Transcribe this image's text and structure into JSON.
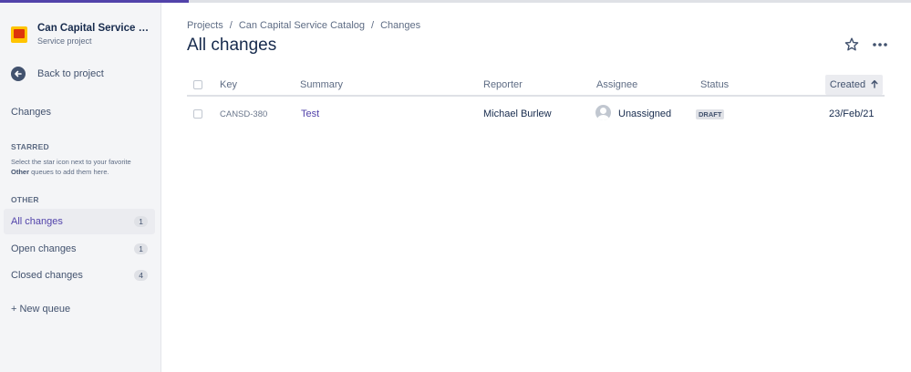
{
  "colors": {
    "accent": "#5243aa",
    "sidebar_bg": "#f4f5f7",
    "logo_yellow": "#ffc400",
    "logo_red": "#de350b"
  },
  "sidebar": {
    "project_name": "Can Capital Service Cata...",
    "project_type": "Service project",
    "back_label": "Back to project",
    "section_title": "Changes",
    "starred_heading": "STARRED",
    "starred_help_1": "Select the star icon next to your favorite",
    "starred_help_bold": "Other",
    "starred_help_2": " queues to add them here.",
    "other_heading": "OTHER",
    "queues": [
      {
        "label": "All changes",
        "count": "1",
        "active": true
      },
      {
        "label": "Open changes",
        "count": "1",
        "active": false
      },
      {
        "label": "Closed changes",
        "count": "4",
        "active": false
      }
    ],
    "new_queue": "+ New queue"
  },
  "breadcrumb": [
    "Projects",
    "Can Capital Service Catalog",
    "Changes"
  ],
  "page_title": "All changes",
  "table": {
    "columns": [
      "Key",
      "Summary",
      "Reporter",
      "Assignee",
      "Status",
      "Created"
    ],
    "sorted_by": "Created",
    "sort_direction": "ascending",
    "rows": [
      {
        "key": "CANSD-380",
        "summary": "Test",
        "reporter": "Michael Burlew",
        "assignee": "Unassigned",
        "status": "DRAFT",
        "created": "23/Feb/21"
      }
    ]
  }
}
